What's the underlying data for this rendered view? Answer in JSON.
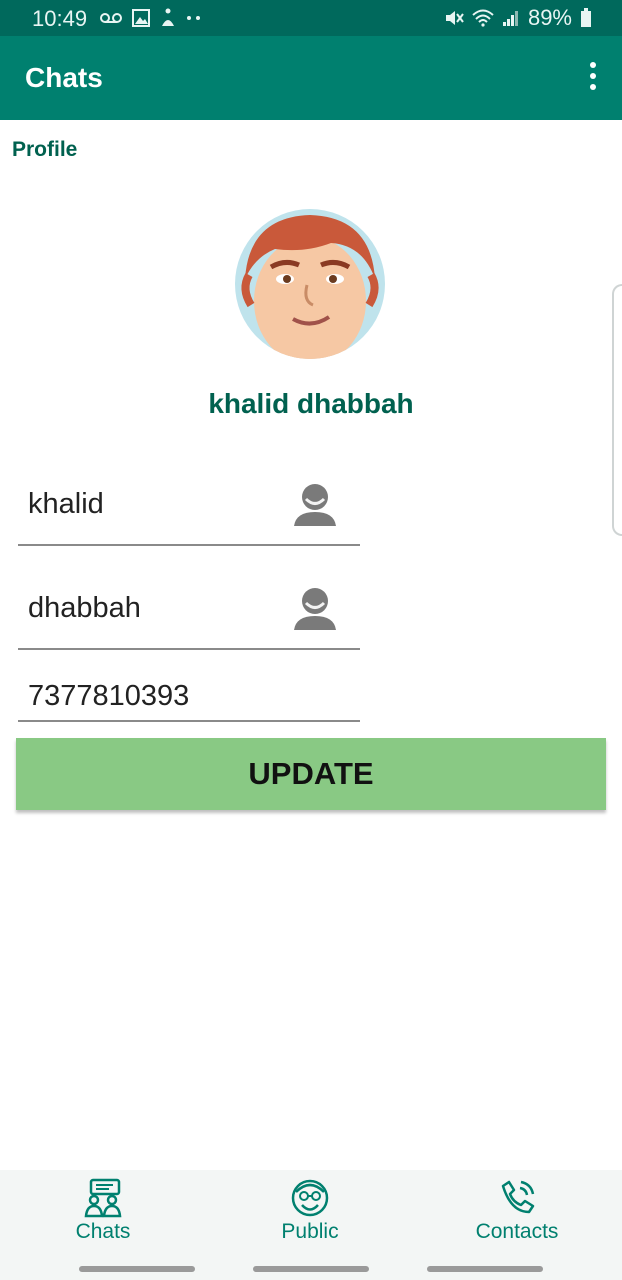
{
  "status_bar": {
    "time": "10:49",
    "battery": "89%"
  },
  "app_bar": {
    "title": "Chats"
  },
  "profile": {
    "section_label": "Profile",
    "display_name": "khalid dhabbah",
    "first_name": "khalid",
    "last_name": "dhabbah",
    "phone": "7377810393",
    "update_label": "UPDATE"
  },
  "bottom_nav": {
    "items": [
      {
        "label": "Chats",
        "icon": "chats-icon"
      },
      {
        "label": "Public",
        "icon": "public-icon"
      },
      {
        "label": "Contacts",
        "icon": "contacts-icon"
      }
    ]
  },
  "colors": {
    "status_bar": "#00695c",
    "app_bar": "#00806f",
    "accent_text": "#00614f",
    "update_button": "#89c984"
  }
}
